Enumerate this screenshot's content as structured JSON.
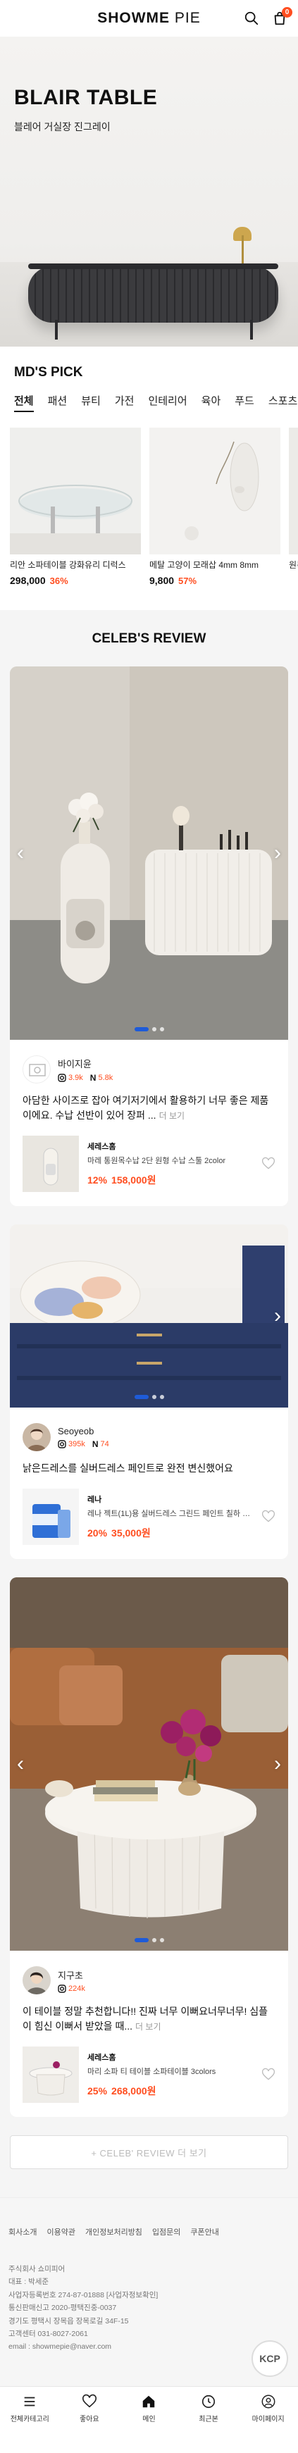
{
  "header": {
    "logo_main": "SHOWME",
    "logo_sub": "PIE",
    "cart_count": "0"
  },
  "hero": {
    "title": "BLAIR TABLE",
    "subtitle": "블레어 거실장 진그레이"
  },
  "mdpick": {
    "title": "MD'S PICK",
    "tabs": [
      "전체",
      "패션",
      "뷰티",
      "가전",
      "인테리어",
      "육아",
      "푸드",
      "스포츠"
    ],
    "products": [
      {
        "name": "리안 소파테이블 강화유리 디럭스",
        "price": "298,000",
        "discount": "36%"
      },
      {
        "name": "메탈 고양이 모래삽 4mm 8mm",
        "price": "9,800",
        "discount": "57%"
      },
      {
        "name": "원목"
      }
    ]
  },
  "celeb": {
    "title": "CELEB'S REVIEW",
    "more_label": "+ CELEB' REVIEW 더 보기",
    "reviews": [
      {
        "user": "바이지윤",
        "followers": "3.9k",
        "nstat": "5.8k",
        "text": "아담한 사이즈로 잡아 여기저기에서 활용하기 너무 좋은 제품이에요. 수납 선반이 있어 장퍼 ...",
        "more": "더 보기",
        "brand": "세레스홈",
        "product": "마레 통원목수납 2단 원형 수납 스툴 2color",
        "percent": "12%",
        "price": "158,000원"
      },
      {
        "user": "Seoyeob",
        "followers": "395k",
        "nstat": "74",
        "text": "낡은드레스를 실버드레스 페인트로 완전 변신했어요",
        "more": "",
        "brand": "레나",
        "product": "레나 젝트(1L)용 실버드레스 그린드 페인트 칠하 친환경 ...",
        "percent": "20%",
        "price": "35,000원"
      },
      {
        "user": "지구초",
        "followers": "224k",
        "text": "이 테이블 정말 추천합니다!! 진짜 너무 이뻐요너무너무! 심플이 힘신 이뻐서 받았을 때...",
        "more": "더 보기",
        "brand": "세레스홈",
        "product": "마리 소파 티 테이블 소파테이블 3colors",
        "percent": "25%",
        "price": "268,000원"
      }
    ]
  },
  "footer": {
    "links": [
      "회사소개",
      "이용약관",
      "개인정보처리방침",
      "입점문의",
      "쿠폰안내"
    ],
    "info": [
      "주식회사 쇼미피어",
      "대표 : 박세준",
      "사업자등록번호 274-87-01888 [사업자정보확인]",
      "통신판매신고 2020-평택진중-0037",
      "경기도 평택시 장목읍 장목로길 34F-15",
      "고객센터 031-8027-2061",
      "email : showmepie@naver.com"
    ],
    "kcp": "KCP"
  },
  "nav": {
    "items": [
      "전체카테고리",
      "좋아요",
      "메인",
      "최근본",
      "마이페이지"
    ]
  },
  "colors": {
    "accent": "#ff4d1f",
    "dot_active": "#1e5bd8"
  }
}
